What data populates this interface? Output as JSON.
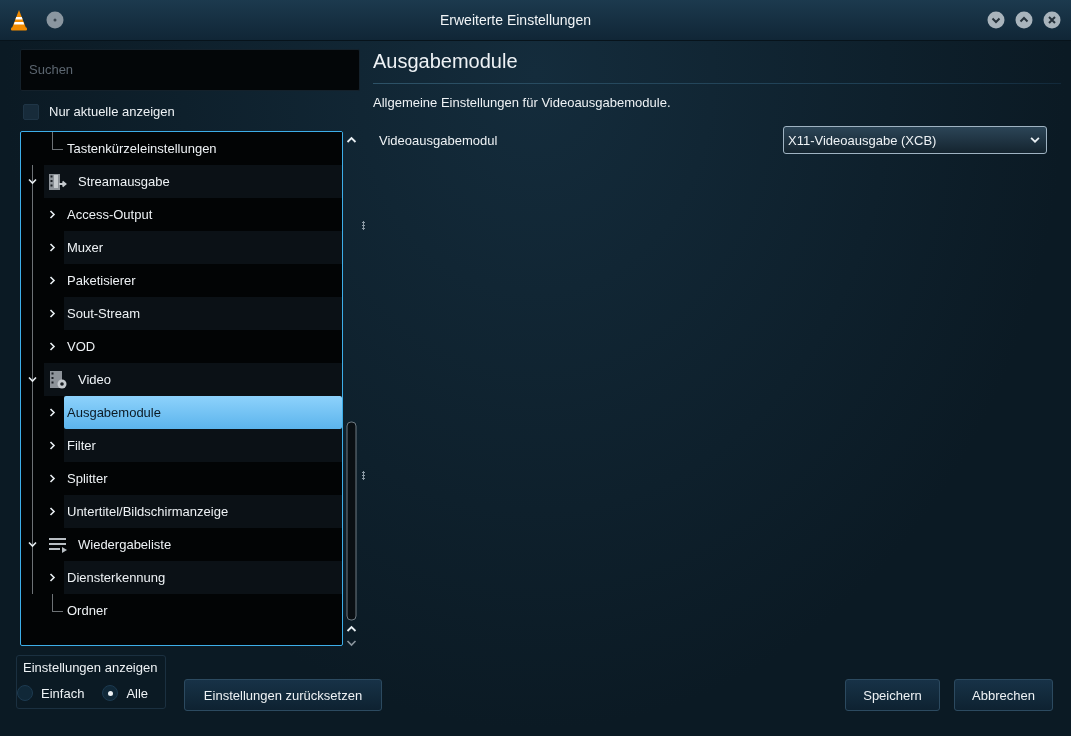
{
  "window": {
    "title": "Erweiterte Einstellungen"
  },
  "search": {
    "placeholder": "Suchen"
  },
  "only_current": {
    "label": "Nur aktuelle anzeigen",
    "checked": false
  },
  "tree": {
    "cut_parent_children": [
      {
        "label": "Tastenkürzeleinstellungen",
        "selected": false
      }
    ],
    "items": [
      {
        "label": "Streamausgabe",
        "expanded": true,
        "selected": false,
        "children": [
          {
            "label": "Access-Output",
            "expanded": false,
            "selected": false
          },
          {
            "label": "Muxer",
            "expanded": false,
            "selected": false
          },
          {
            "label": "Paketisierer",
            "expanded": false,
            "selected": false
          },
          {
            "label": "Sout-Stream",
            "expanded": false,
            "selected": false
          },
          {
            "label": "VOD",
            "expanded": false,
            "selected": false
          }
        ]
      },
      {
        "label": "Video",
        "expanded": true,
        "selected": false,
        "children": [
          {
            "label": "Ausgabemodule",
            "expanded": false,
            "selected": true
          },
          {
            "label": "Filter",
            "expanded": false,
            "selected": false
          },
          {
            "label": "Splitter",
            "expanded": false,
            "selected": false
          },
          {
            "label": "Untertitel/Bildschirmanzeige",
            "expanded": false,
            "selected": false
          }
        ]
      },
      {
        "label": "Wiedergabeliste",
        "expanded": true,
        "selected": false,
        "children": [
          {
            "label": "Diensterkennung",
            "expanded": false,
            "selected": false
          },
          {
            "label": "Ordner",
            "selected": false
          }
        ]
      }
    ]
  },
  "panel": {
    "title": "Ausgabemodule",
    "description": "Allgemeine Einstellungen für Videoausgabemodule.",
    "settings": [
      {
        "label": "Videoausgabemodul",
        "value": "X11-Videoausgabe (XCB)"
      }
    ]
  },
  "view_mode": {
    "title": "Einstellungen anzeigen",
    "options": [
      {
        "label": "Einfach",
        "selected": false
      },
      {
        "label": "Alle",
        "selected": true
      }
    ]
  },
  "reset_button": "Einstellungen zurücksetzen",
  "buttons": [
    "Speichern",
    "Abbrechen"
  ]
}
